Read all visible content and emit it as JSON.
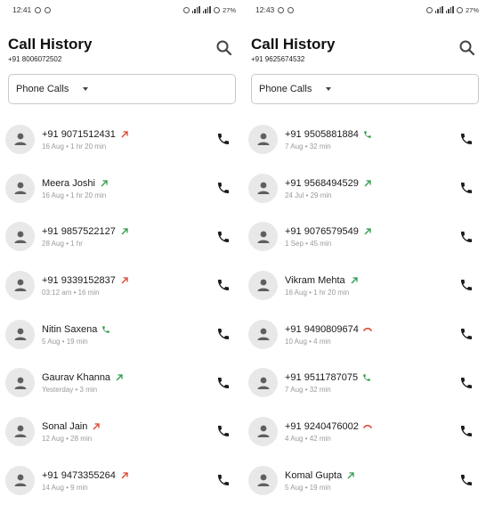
{
  "colors": {
    "outgoing": "#d9442e",
    "incoming": "#2e9b4a",
    "missed": "#d9442e",
    "answered": "#2e9b4a"
  },
  "panels": [
    {
      "status": {
        "time": "12:41",
        "battery": "27%"
      },
      "title": "Call History",
      "phone": "+91 8006072502",
      "filter": "Phone Calls",
      "calls": [
        {
          "name": "+91 9071512431",
          "type": "outgoing",
          "meta": "16 Aug • 1 hr 20 min"
        },
        {
          "name": "Meera Joshi",
          "type": "incoming",
          "meta": "16 Aug • 1 hr 20 min"
        },
        {
          "name": "+91 9857522127",
          "type": "incoming",
          "meta": "28 Aug • 1 hr"
        },
        {
          "name": "+91 9339152837",
          "type": "outgoing",
          "meta": "03:12 am • 16 min"
        },
        {
          "name": "Nitin Saxena",
          "type": "answered",
          "meta": "5 Aug • 19 min"
        },
        {
          "name": "Gaurav Khanna",
          "type": "incoming",
          "meta": "Yesterday • 3 min"
        },
        {
          "name": "Sonal Jain",
          "type": "outgoing",
          "meta": "12 Aug • 28 min"
        },
        {
          "name": "+91 9473355264",
          "type": "outgoing",
          "meta": "14 Aug • 9 min"
        }
      ]
    },
    {
      "status": {
        "time": "12:43",
        "battery": "27%"
      },
      "title": "Call History",
      "phone": "+91 9625674532",
      "filter": "Phone Calls",
      "calls": [
        {
          "name": "+91 9505881884",
          "type": "answered",
          "meta": "7 Aug • 32 min"
        },
        {
          "name": "+91 9568494529",
          "type": "incoming",
          "meta": "24 Jul • 29 min"
        },
        {
          "name": "+91 9076579549",
          "type": "incoming",
          "meta": "1 Sep • 45 min"
        },
        {
          "name": "Vikram Mehta",
          "type": "incoming",
          "meta": "16 Aug • 1 hr 20 min"
        },
        {
          "name": "+91 9490809674",
          "type": "missed",
          "meta": "10 Aug • 4 min"
        },
        {
          "name": "+91 9511787075",
          "type": "answered",
          "meta": "7 Aug • 32 min"
        },
        {
          "name": "+91 9240476002",
          "type": "missed",
          "meta": "4 Aug • 42 min"
        },
        {
          "name": "Komal Gupta",
          "type": "incoming",
          "meta": "5 Aug • 19 min"
        }
      ]
    }
  ]
}
